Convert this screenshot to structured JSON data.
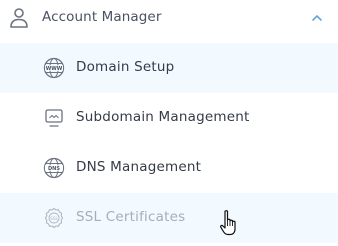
{
  "menu": {
    "header": {
      "title": "Account Manager",
      "icon": "user-icon",
      "toggle_icon": "chevron-up-icon",
      "expanded": true
    },
    "items": [
      {
        "label": "Domain Setup",
        "icon": "www-globe-icon"
      },
      {
        "label": "Subdomain Management",
        "icon": "monitor-icon"
      },
      {
        "label": "DNS Management",
        "icon": "dns-globe-icon"
      },
      {
        "label": "SSL Certificates",
        "icon": "ssl-badge-icon",
        "disabled": true
      }
    ]
  },
  "cursor": {
    "icon": "hand-pointer-cursor"
  },
  "colors": {
    "accent": "#6aa3d6",
    "row_highlight": "#f2f9ff",
    "text": "#353b47",
    "text_disabled": "#a8adb6",
    "icon": "#6b7280"
  }
}
